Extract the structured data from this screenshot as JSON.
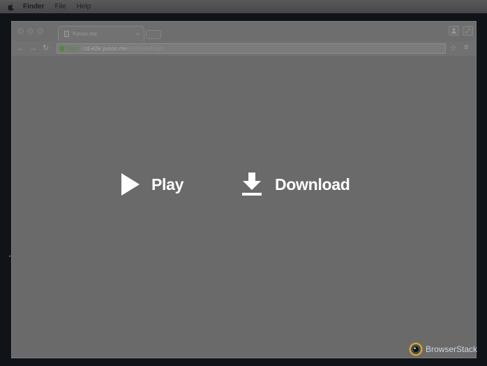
{
  "menubar": {
    "items": [
      {
        "label": "Finder",
        "bold": true
      },
      {
        "label": "File",
        "bold": false
      },
      {
        "label": "Help",
        "bold": false
      }
    ]
  },
  "browser": {
    "tab_title": "Yunoo.me",
    "address": {
      "scheme": "https",
      "separator": "://",
      "host": "cd-e2e.yunoo.me",
      "path": "/ui/#/user/login"
    }
  },
  "content": {
    "play_label": "Play",
    "download_label": "Download"
  },
  "watermark": {
    "brand": "BrowserStack"
  },
  "colors": {
    "overlay_bg": "#6a6a6a",
    "overlay_text": "#ffffff",
    "https_green": "#4e8c3f"
  }
}
